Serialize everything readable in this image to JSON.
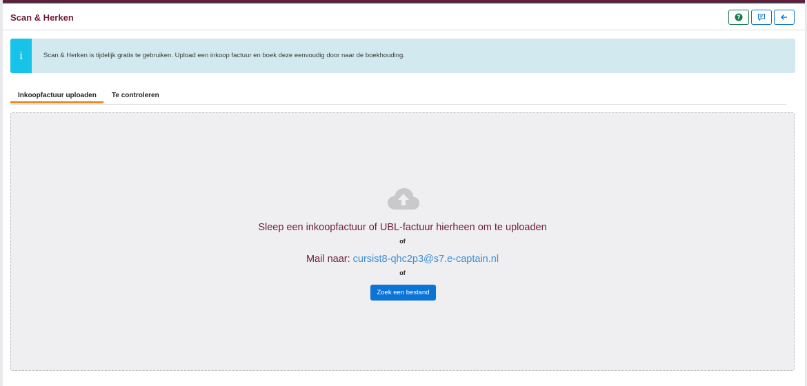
{
  "header": {
    "title": "Scan & Herken",
    "buttons": [
      {
        "icon": "help-icon",
        "label": ""
      },
      {
        "icon": "feedback-icon",
        "label": ""
      },
      {
        "icon": "arrow-left-icon",
        "label": ""
      }
    ]
  },
  "info": {
    "icon": "i",
    "message": "Scan & Herken is tijdelijk gratis te gebruiken. Upload een inkoop factuur en boek deze eenvoudig door naar de boekhouding."
  },
  "tabs": [
    {
      "label": "Inkoopfactuur uploaden",
      "active": true
    },
    {
      "label": "Te controleren",
      "active": false
    }
  ],
  "dropzone": {
    "drag_text": "Sleep een inkoopfactuur of UBL-factuur hierheen om te uploaden",
    "or_text_1": "of",
    "mail_prefix": "Mail naar:",
    "mail_address": "cursist8-qhc2p3@s7.e-captain.nl",
    "or_text_2": "of",
    "choose_button": "Zoek een bestand"
  },
  "colors": {
    "brand": "#6b1d3c",
    "accent_orange": "#e8891d",
    "button_blue": "#0b74d6",
    "info_bg": "#d1e9ef",
    "info_stripe": "#17c3e8",
    "help_green": "#1a7a4c"
  }
}
